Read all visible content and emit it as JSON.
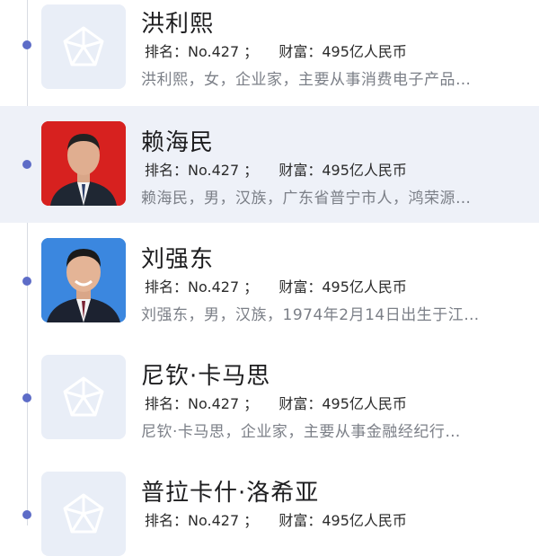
{
  "people": [
    {
      "name": "洪利熙",
      "rank_label": "排名：",
      "rank_value": "No.427",
      "sep": "；",
      "wealth_label": "财富：",
      "wealth_value": "495亿人民币",
      "description": "洪利熙，女，企业家，主要从事消费电子产品…",
      "avatar": "placeholder-icon"
    },
    {
      "name": "赖海民",
      "rank_label": "排名：",
      "rank_value": "No.427",
      "sep": "；",
      "wealth_label": "财富：",
      "wealth_value": "495亿人民币",
      "description": "赖海民，男，汉族，广东省普宁市人，鸿荣源…",
      "avatar": "portrait-photo"
    },
    {
      "name": "刘强东",
      "rank_label": "排名：",
      "rank_value": "No.427",
      "sep": "；",
      "wealth_label": "财富：",
      "wealth_value": "495亿人民币",
      "description": "刘强东，男，汉族，1974年2月14日出生于江…",
      "avatar": "portrait-photo"
    },
    {
      "name": "尼钦·卡马思",
      "rank_label": "排名：",
      "rank_value": "No.427",
      "sep": "；",
      "wealth_label": "财富：",
      "wealth_value": "495亿人民币",
      "description": "尼钦·卡马思，企业家，主要从事金融经纪行…",
      "avatar": "placeholder-icon"
    },
    {
      "name": "普拉卡什·洛希亚",
      "rank_label": "排名：",
      "rank_value": "No.427",
      "sep": "；",
      "wealth_label": "财富：",
      "wealth_value": "495亿人民币",
      "description": "",
      "avatar": "placeholder-icon"
    }
  ],
  "colors": {
    "accent": "#5d6cc7",
    "highlight_bg": "#eef1f8",
    "placeholder_bg": "#e9eef7",
    "desc_text": "#7b7f87"
  }
}
